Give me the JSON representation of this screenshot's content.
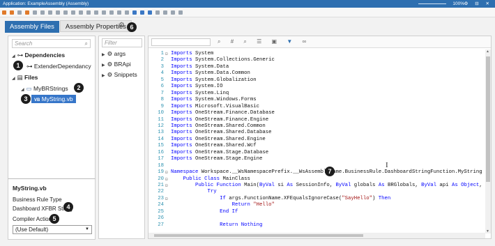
{
  "titlebar": {
    "title": "Application: ExampleAssembly (Assembly)",
    "zoom": "100%",
    "window_controls": "⚙ ⊟ ✕"
  },
  "tabs": [
    {
      "label": "Assembly Files",
      "active": true
    },
    {
      "label": "Assembly Properties",
      "active": false
    }
  ],
  "left": {
    "search_placeholder": "Search",
    "dependencies_label": "Dependencies",
    "dependency_item": "ExtenderDependancy",
    "files_label": "Files",
    "folder_label": "MyBRStrings",
    "file_type": "VB",
    "file_label": "MyString.vb"
  },
  "props": {
    "title": "MyString.vb",
    "business_rule_type_label": "Business Rule Type",
    "business_rule_type_value": "Dashboard XFBR String",
    "compiler_action_label": "Compiler Action",
    "compiler_action_value": "(Use Default)"
  },
  "middle": {
    "filter_placeholder": "Filter",
    "items": [
      "args",
      "BRApi",
      "Snippets"
    ]
  },
  "badges": [
    "1",
    "2",
    "3",
    "4",
    "5",
    "6",
    "7"
  ],
  "code_lines": [
    {
      "n": "1",
      "fold": "⊟",
      "parts": [
        [
          "kw",
          "Imports"
        ],
        [
          "t",
          " System"
        ]
      ]
    },
    {
      "n": "2",
      "fold": "",
      "parts": [
        [
          "kw",
          "Imports"
        ],
        [
          "t",
          " System.Collections.Generic"
        ]
      ]
    },
    {
      "n": "3",
      "fold": "",
      "parts": [
        [
          "kw",
          "Imports"
        ],
        [
          "t",
          " System.Data"
        ]
      ]
    },
    {
      "n": "4",
      "fold": "",
      "parts": [
        [
          "kw",
          "Imports"
        ],
        [
          "t",
          " System.Data.Common"
        ]
      ]
    },
    {
      "n": "5",
      "fold": "",
      "parts": [
        [
          "kw",
          "Imports"
        ],
        [
          "t",
          " System.Globalization"
        ]
      ]
    },
    {
      "n": "6",
      "fold": "",
      "parts": [
        [
          "kw",
          "Imports"
        ],
        [
          "t",
          " System.IO"
        ]
      ]
    },
    {
      "n": "7",
      "fold": "",
      "parts": [
        [
          "kw",
          "Imports"
        ],
        [
          "t",
          " System.Linq"
        ]
      ]
    },
    {
      "n": "8",
      "fold": "",
      "parts": [
        [
          "kw",
          "Imports"
        ],
        [
          "t",
          " System.Windows.Forms"
        ]
      ]
    },
    {
      "n": "9",
      "fold": "",
      "parts": [
        [
          "kw",
          "Imports"
        ],
        [
          "t",
          " Microsoft.VisualBasic"
        ]
      ]
    },
    {
      "n": "10",
      "fold": "",
      "parts": [
        [
          "kw",
          "Imports"
        ],
        [
          "t",
          " OneStream.Finance.Database"
        ]
      ]
    },
    {
      "n": "11",
      "fold": "",
      "parts": [
        [
          "kw",
          "Imports"
        ],
        [
          "t",
          " OneStream.Finance.Engine"
        ]
      ]
    },
    {
      "n": "12",
      "fold": "",
      "parts": [
        [
          "kw",
          "Imports"
        ],
        [
          "t",
          " OneStream.Shared.Common"
        ]
      ]
    },
    {
      "n": "13",
      "fold": "",
      "parts": [
        [
          "kw",
          "Imports"
        ],
        [
          "t",
          " OneStream.Shared.Database"
        ]
      ]
    },
    {
      "n": "14",
      "fold": "",
      "parts": [
        [
          "kw",
          "Imports"
        ],
        [
          "t",
          " OneStream.Shared.Engine"
        ]
      ]
    },
    {
      "n": "15",
      "fold": "",
      "parts": [
        [
          "kw",
          "Imports"
        ],
        [
          "t",
          " OneStream.Shared.Wcf"
        ]
      ]
    },
    {
      "n": "16",
      "fold": "",
      "parts": [
        [
          "kw",
          "Imports"
        ],
        [
          "t",
          " OneStream.Stage.Database"
        ]
      ]
    },
    {
      "n": "17",
      "fold": "",
      "parts": [
        [
          "kw",
          "Imports"
        ],
        [
          "t",
          " OneStream.Stage.Engine"
        ]
      ]
    },
    {
      "n": "18",
      "fold": "",
      "parts": [
        [
          "t",
          ""
        ]
      ]
    },
    {
      "n": "19",
      "fold": "⊟",
      "parts": [
        [
          "kw",
          "Namespace"
        ],
        [
          "t",
          " Workspace.__WsNamespacePrefix.__WsAssemblyName.BusinessRule.DashboardStringFunction.MyString"
        ]
      ]
    },
    {
      "n": "20",
      "fold": "⊟",
      "parts": [
        [
          "t",
          "    "
        ],
        [
          "kw",
          "Public Class"
        ],
        [
          "t",
          " MainClass"
        ]
      ]
    },
    {
      "n": "21",
      "fold": "⊟",
      "parts": [
        [
          "t",
          "        "
        ],
        [
          "kw",
          "Public Function"
        ],
        [
          "t",
          " Main("
        ],
        [
          "kw",
          "ByVal"
        ],
        [
          "t",
          " si "
        ],
        [
          "kw",
          "As"
        ],
        [
          "t",
          " SessionInfo, "
        ],
        [
          "kw",
          "ByVal"
        ],
        [
          "t",
          " globals "
        ],
        [
          "kw",
          "As"
        ],
        [
          "t",
          " BRGlobals, "
        ],
        [
          "kw",
          "ByVal"
        ],
        [
          "t",
          " api "
        ],
        [
          "kw",
          "As Object"
        ],
        [
          "t",
          ","
        ]
      ]
    },
    {
      "n": "22",
      "fold": "",
      "parts": [
        [
          "t",
          "            "
        ],
        [
          "kw",
          "Try"
        ]
      ]
    },
    {
      "n": "23",
      "fold": "⊟",
      "parts": [
        [
          "t",
          "                "
        ],
        [
          "kw",
          "If"
        ],
        [
          "t",
          " args.FunctionName.XFEqualsIgnoreCase("
        ],
        [
          "str",
          "\"SayHello\""
        ],
        [
          "t",
          ") "
        ],
        [
          "kw",
          "Then"
        ]
      ]
    },
    {
      "n": "24",
      "fold": "",
      "parts": [
        [
          "t",
          "                    "
        ],
        [
          "kw",
          "Return"
        ],
        [
          "t",
          " "
        ],
        [
          "str",
          "\"Hello\""
        ]
      ]
    },
    {
      "n": "25",
      "fold": "",
      "parts": [
        [
          "t",
          "                "
        ],
        [
          "kw",
          "End If"
        ]
      ]
    },
    {
      "n": "26",
      "fold": "",
      "parts": [
        [
          "t",
          ""
        ]
      ]
    },
    {
      "n": "27",
      "fold": "",
      "parts": [
        [
          "t",
          "                "
        ],
        [
          "kw",
          "Return Nothing"
        ]
      ]
    }
  ]
}
